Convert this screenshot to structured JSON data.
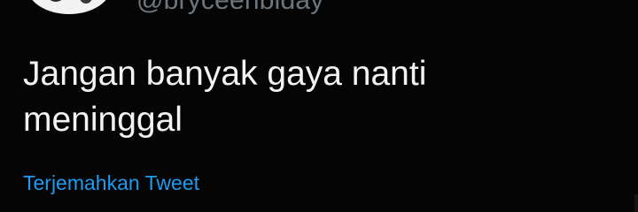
{
  "tweet": {
    "handle": "@bryceenbiday",
    "text": "Jangan banyak gaya nanti meninggal",
    "translate_label": "Terjemahkan Tweet"
  },
  "colors": {
    "background": "#000000",
    "text": "#f2f2f2",
    "handle": "#6e767d",
    "link": "#1d9bf0"
  },
  "icons": {
    "avatar": "user-avatar"
  }
}
